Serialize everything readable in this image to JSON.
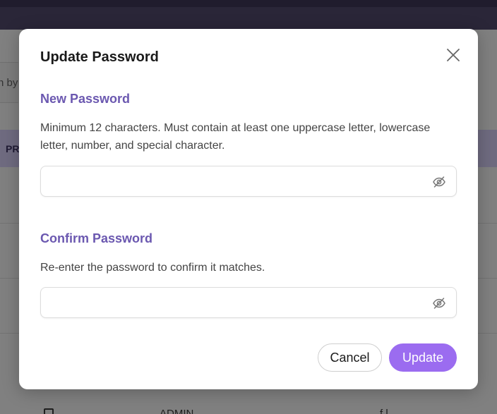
{
  "background": {
    "search_fragment": "n by",
    "header_fragment": "PR",
    "bottom_text_1": "ADMIN",
    "bottom_text_2": "f l"
  },
  "modal": {
    "title": "Update Password",
    "close_icon": "close-icon",
    "new_password": {
      "label": "New Password",
      "hint": "Minimum 12 characters. Must contain at least one uppercase letter, lowercase letter, number, and special character.",
      "value": "",
      "icon": "eye-off-icon"
    },
    "confirm_password": {
      "label": "Confirm Password",
      "hint": "Re-enter the password to confirm it matches.",
      "value": "",
      "icon": "eye-off-icon"
    },
    "buttons": {
      "cancel": "Cancel",
      "update": "Update"
    }
  },
  "colors": {
    "accent": "#9b6cf0",
    "label": "#6b58b0"
  }
}
